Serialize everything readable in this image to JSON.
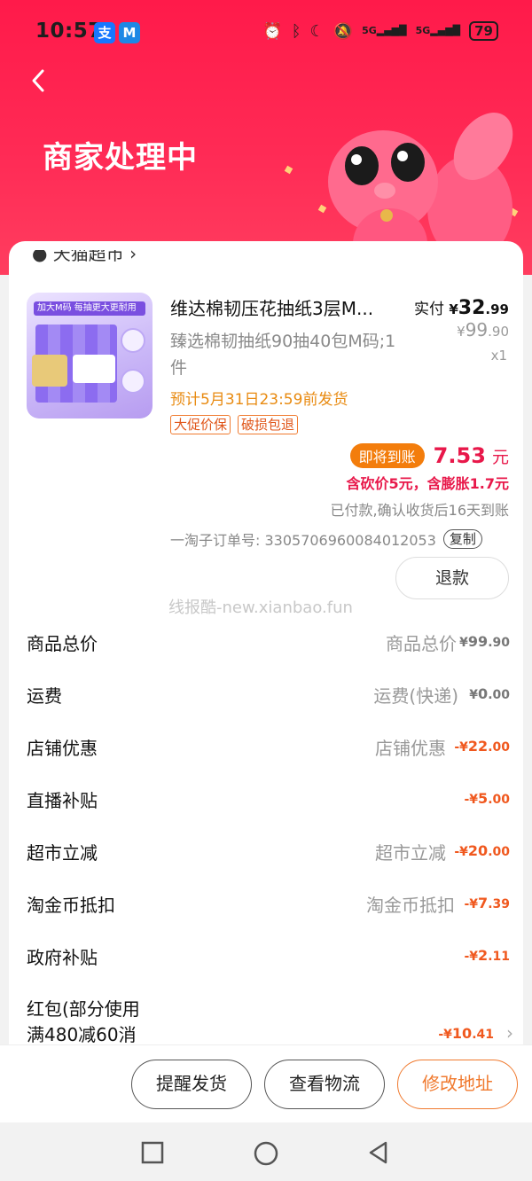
{
  "status_bar": {
    "time": "10:57",
    "app_badges": [
      "支",
      "M"
    ],
    "sys_icons": [
      "alarm-icon",
      "bluetooth-icon",
      "moon-icon",
      "mute-icon"
    ],
    "signal_labels": [
      "5G",
      "5G"
    ],
    "battery": "79"
  },
  "header": {
    "title": "商家处理中"
  },
  "order": {
    "product": {
      "title": "维达棉韧压花抽纸3层M...",
      "spec": "臻选棉韧抽纸90抽40包M码;1件",
      "ship_note": "预计5月31日23:59前发货",
      "tags": [
        "大促价保",
        "破损包退"
      ],
      "image_text": "加大M码 每抽更大更耐用",
      "image_badge": "M码"
    },
    "price": {
      "paid_label": "实付",
      "paid_currency": "¥",
      "paid_int": "32",
      "paid_dec": ".99",
      "orig_currency": "¥",
      "orig_int": "99",
      "orig_dec": ".90",
      "qty": "x1"
    },
    "arrive": {
      "badge": "即将到账",
      "amount": "7.53",
      "unit": "元",
      "bargain_note": "含砍价5元，含膨胀1.7元",
      "settle_note": "已付款,确认收货后16天到账"
    },
    "suborder_label": "一淘子订单号: 3305706960084012053",
    "copy_label": "复制",
    "refund_label": "退款"
  },
  "fees": [
    {
      "label": "商品总价",
      "hint": "商品总价",
      "currency": "¥",
      "int": "99",
      "dec": ".90",
      "red": false
    },
    {
      "label": "运费",
      "hint": "运费(快递)",
      "currency": "¥",
      "int": "0",
      "dec": ".00",
      "red": false
    },
    {
      "label": "店铺优惠",
      "hint": "店铺优惠",
      "currency": "-¥",
      "int": "22",
      "dec": ".00",
      "red": true
    },
    {
      "label": "直播补贴",
      "hint": "",
      "currency": "-¥",
      "int": "5",
      "dec": ".00",
      "red": true
    },
    {
      "label": "超市立减",
      "hint": "超市立减",
      "currency": "-¥",
      "int": "20",
      "dec": ".00",
      "red": true
    },
    {
      "label": "淘金币抵扣",
      "hint": "淘金币抵扣",
      "currency": "-¥",
      "int": "7",
      "dec": ".39",
      "red": true
    },
    {
      "label": "政府补贴",
      "hint": "",
      "currency": "-¥",
      "int": "2",
      "dec": ".11",
      "red": true
    },
    {
      "label": "红包(部分使用\n满480减60消",
      "hint": "",
      "currency": "-¥",
      "int": "10",
      "dec": ".41",
      "red": true
    }
  ],
  "watermark": "线报酷-new.xianbao.fun",
  "actions": {
    "remind": "提醒发货",
    "logistics": "查看物流",
    "address": "修改地址"
  },
  "colors": {
    "brand_red": "#ff1a4a",
    "price_red": "#e8184a",
    "discount_orange": "#f0581e",
    "badge_orange": "#f37d0c"
  }
}
